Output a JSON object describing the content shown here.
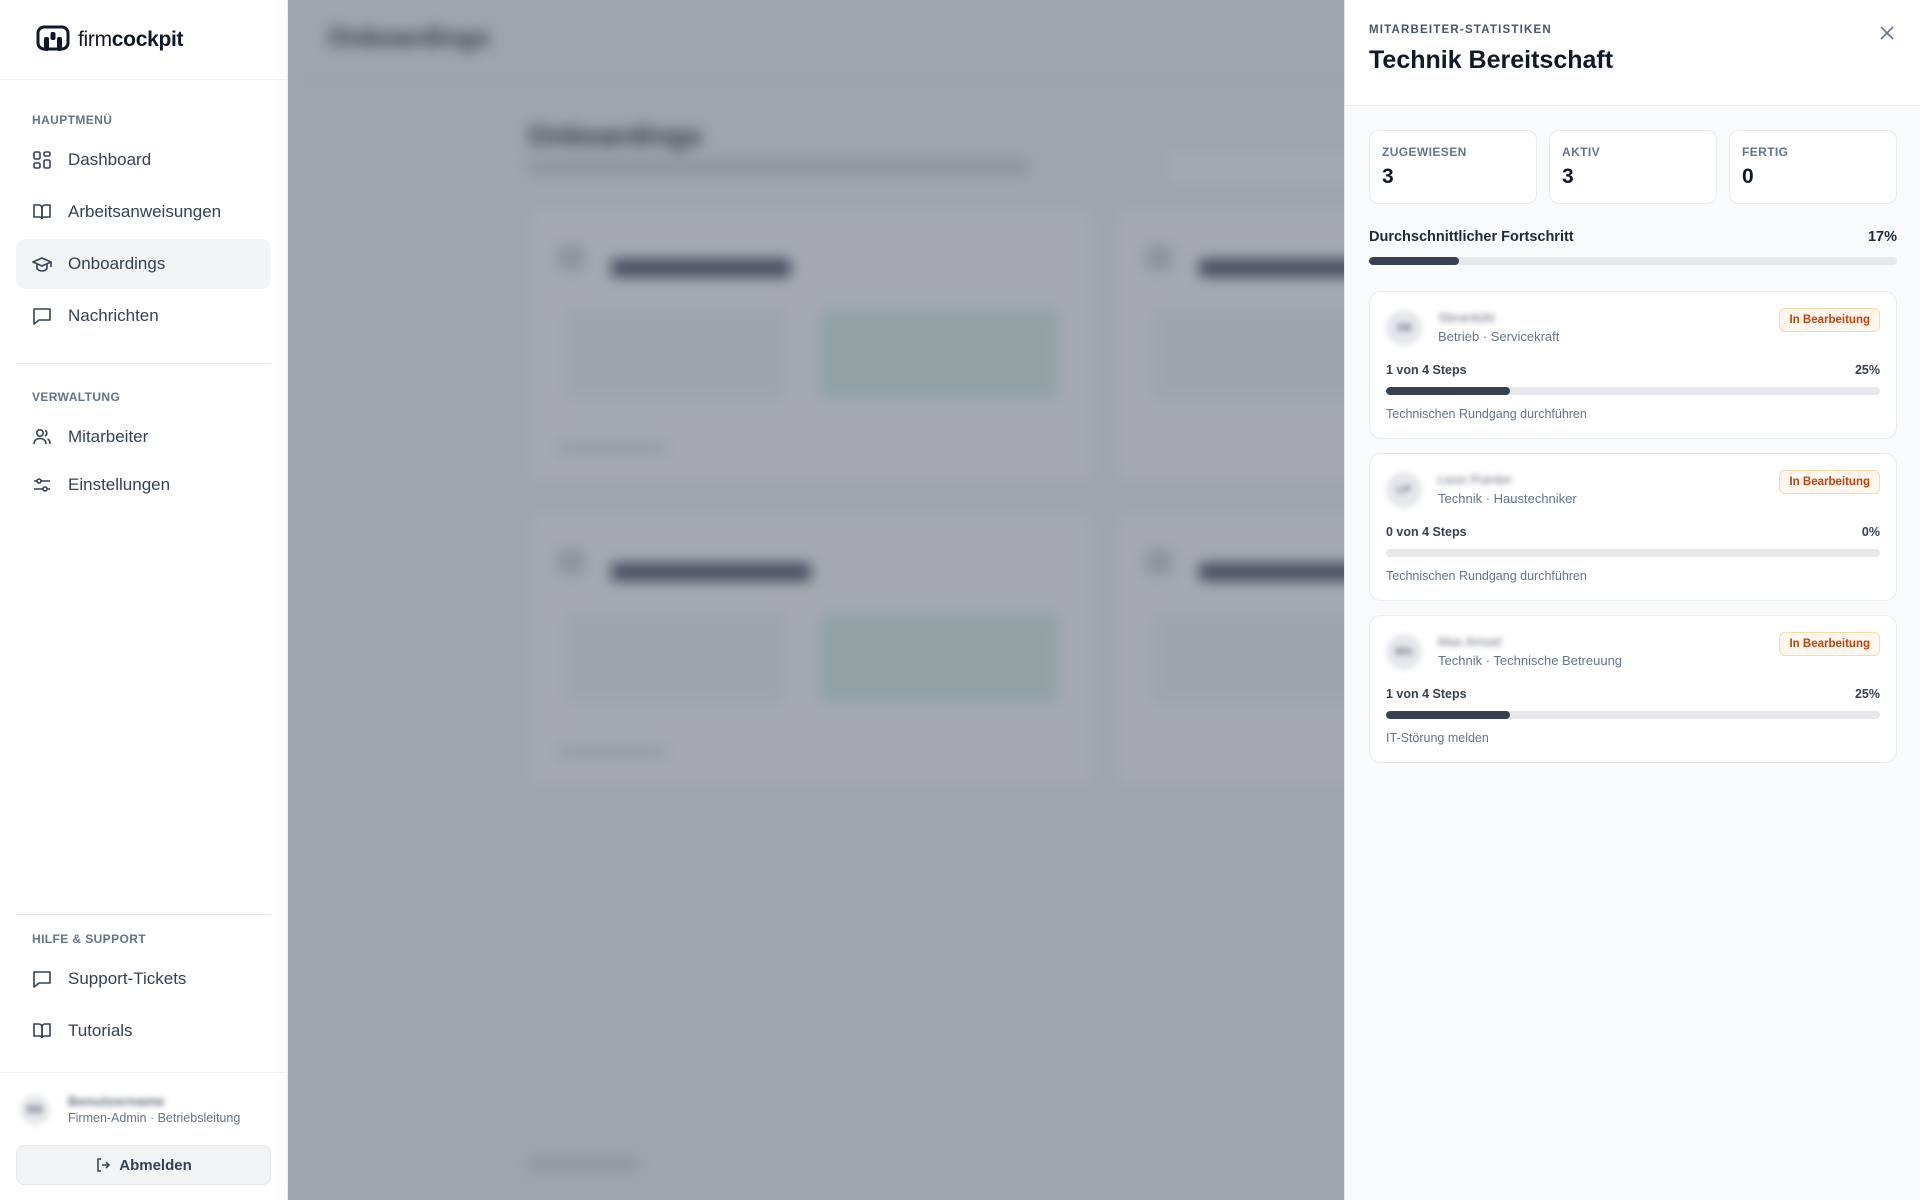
{
  "brand": {
    "name_light": "firm",
    "name_bold": "cockpit"
  },
  "sidebar": {
    "main_title": "HAUPTMENÜ",
    "main_items": [
      {
        "label": "Dashboard",
        "icon": "grid-icon"
      },
      {
        "label": "Arbeitsanweisungen",
        "icon": "book-icon"
      },
      {
        "label": "Onboardings",
        "icon": "graduation-cap-icon",
        "active": true
      },
      {
        "label": "Nachrichten",
        "icon": "message-icon"
      }
    ],
    "admin_title": "VERWALTUNG",
    "admin_items": [
      {
        "label": "Mitarbeiter",
        "icon": "users-icon"
      },
      {
        "label": "Einstellungen",
        "icon": "sliders-icon"
      }
    ],
    "help_title": "HILFE & SUPPORT",
    "help_items": [
      {
        "label": "Support-Tickets",
        "icon": "message-icon"
      },
      {
        "label": "Tutorials",
        "icon": "book-icon"
      }
    ],
    "user": {
      "initials": "BB",
      "name": "Benutzername",
      "role": "Firmen-Admin · Betriebsleitung"
    },
    "logout_label": "Abmelden"
  },
  "background": {
    "page_title": "Onboardings",
    "heading": "Onboardings"
  },
  "panel": {
    "overline": "MITARBEITER-STATISTIKEN",
    "title": "Technik Bereitschaft",
    "stats": [
      {
        "label": "ZUGEWIESEN",
        "value": "3"
      },
      {
        "label": "AKTIV",
        "value": "3"
      },
      {
        "label": "FERTIG",
        "value": "0"
      }
    ],
    "avg_label": "Durchschnittlicher Fortschritt",
    "avg_value": "17%",
    "avg_fraction": 0.17,
    "employees": [
      {
        "initials": "SB",
        "name": "Sbranitzki",
        "role": "Betrieb · Servicekraft",
        "status": "In Bearbeitung",
        "steps": "1 von 4 Steps",
        "pct": "25%",
        "progress": 0.25,
        "task": "Technischen Rundgang durchführen"
      },
      {
        "initials": "LP",
        "name": "Leon Pointer",
        "role": "Technik · Haustechniker",
        "status": "In Bearbeitung",
        "steps": "0 von 4 Steps",
        "pct": "0%",
        "progress": 0,
        "task": "Technischen Rundgang durchführen"
      },
      {
        "initials": "MA",
        "name": "Max Amsel",
        "role": "Technik · Technische Betreuung",
        "status": "In Bearbeitung",
        "steps": "1 von 4 Steps",
        "pct": "25%",
        "progress": 0.25,
        "task": "IT-Störung melden"
      }
    ]
  }
}
